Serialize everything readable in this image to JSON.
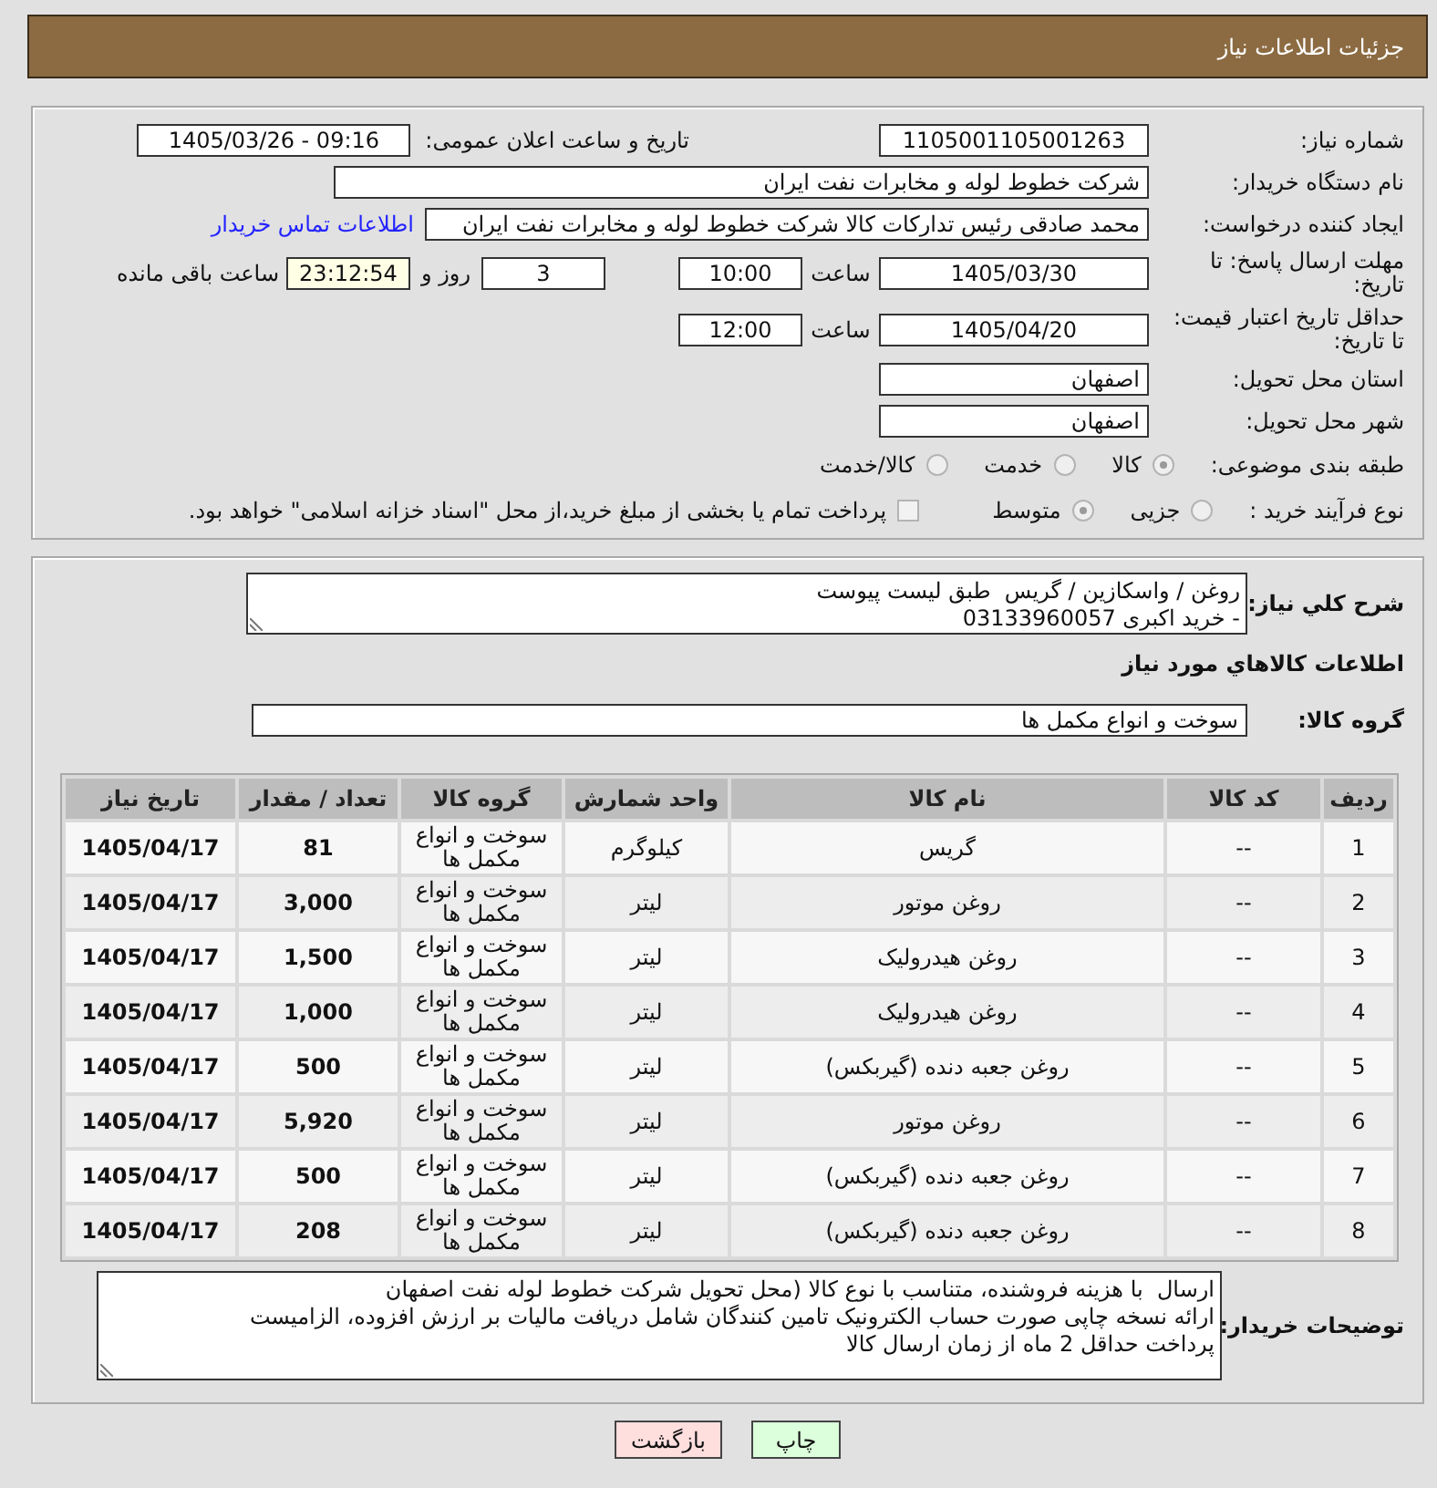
{
  "header": {
    "title": "جزئیات اطلاعات نیاز"
  },
  "details": {
    "need_number": {
      "label": "شماره نیاز:",
      "value": "1105001105001263"
    },
    "announcement": {
      "label": "تاریخ و ساعت اعلان عمومی:",
      "value": "1405/03/26 - 09:16"
    },
    "buyer_org": {
      "label": "نام دستگاه خریدار:",
      "value": "شرکت خطوط لوله و مخابرات نفت ایران"
    },
    "requester": {
      "label": "ایجاد کننده درخواست:",
      "value": "محمد صادقی رئیس تدارکات کالا  شرکت خطوط لوله و مخابرات نفت ایران",
      "link": "اطلاعات تماس خریدار"
    },
    "reply_deadline": {
      "label": "مهلت ارسال پاسخ: تا تاریخ:",
      "date": "1405/03/30",
      "time_label": "ساعت",
      "time": "10:00",
      "days": "3",
      "days_label": "روز و",
      "remaining": "23:12:54",
      "remaining_label": "ساعت باقی مانده"
    },
    "price_validity": {
      "label": "حداقل تاریخ اعتبار قیمت: تا تاریخ:",
      "date": "1405/04/20",
      "time_label": "ساعت",
      "time": "12:00"
    },
    "province": {
      "label": "استان محل تحویل:",
      "value": "اصفهان"
    },
    "city": {
      "label": "شهر محل تحویل:",
      "value": "اصفهان"
    },
    "category": {
      "label": "طبقه بندی موضوعی:",
      "options": [
        {
          "label": "کالا",
          "selected": true
        },
        {
          "label": "خدمت",
          "selected": false
        },
        {
          "label": "کالا/خدمت",
          "selected": false
        }
      ]
    },
    "purchase_process": {
      "label": "نوع فرآیند خرید :",
      "options": [
        {
          "label": "جزیی",
          "selected": false
        },
        {
          "label": "متوسط",
          "selected": true
        }
      ],
      "treasury": {
        "label": "پرداخت تمام یا بخشی از مبلغ خرید،از محل \"اسناد خزانه اسلامی\" خواهد بود.",
        "checked": false
      }
    }
  },
  "need": {
    "description": {
      "label": "شرح کلي نياز:",
      "value": "روغن / واسکازین / گریس  طبق لیست پیوست\n- خرید اکبری 03133960057"
    },
    "items_title": "اطلاعات کالاهاي مورد نياز",
    "group": {
      "label": "گروه کالا:",
      "value": "سوخت و انواع مکمل ها"
    },
    "table": {
      "columns": [
        "ردیف",
        "کد کالا",
        "نام کالا",
        "واحد شمارش",
        "گروه کالا",
        "تعداد / مقدار",
        "تاریخ نیاز"
      ],
      "rows": [
        [
          "1",
          "--",
          "گریس",
          "کیلوگرم",
          "سوخت و انواع مکمل ها",
          "81",
          "1405/04/17"
        ],
        [
          "2",
          "--",
          "روغن موتور",
          "لیتر",
          "سوخت و انواع مکمل ها",
          "3,000",
          "1405/04/17"
        ],
        [
          "3",
          "--",
          "روغن هیدرولیک",
          "لیتر",
          "سوخت و انواع مکمل ها",
          "1,500",
          "1405/04/17"
        ],
        [
          "4",
          "--",
          "روغن هیدرولیک",
          "لیتر",
          "سوخت و انواع مکمل ها",
          "1,000",
          "1405/04/17"
        ],
        [
          "5",
          "--",
          "روغن جعبه دنده (گیربکس)",
          "لیتر",
          "سوخت و انواع مکمل ها",
          "500",
          "1405/04/17"
        ],
        [
          "6",
          "--",
          "روغن موتور",
          "لیتر",
          "سوخت و انواع مکمل ها",
          "5,920",
          "1405/04/17"
        ],
        [
          "7",
          "--",
          "روغن جعبه دنده (گیربکس)",
          "لیتر",
          "سوخت و انواع مکمل ها",
          "500",
          "1405/04/17"
        ],
        [
          "8",
          "--",
          "روغن جعبه دنده (گیربکس)",
          "لیتر",
          "سوخت و انواع مکمل ها",
          "208",
          "1405/04/17"
        ]
      ]
    },
    "buyer_notes": {
      "label": "توضیحات خریدار:",
      "value": "ارسال  با هزینه فروشنده، متناسب با نوع کالا (محل تحویل شرکت خطوط لوله نفت اصفهان\nارائه نسخه چاپی صورت حساب الکترونیک تامین کنندگان شامل دریافت مالیات بر ارزش افزوده، الزامیست\nپرداخت حداقل 2 ماه از زمان ارسال کالا"
    }
  },
  "buttons": [
    {
      "label": "چاپ",
      "kind": "print"
    },
    {
      "label": "بازگشت",
      "kind": "back"
    }
  ]
}
